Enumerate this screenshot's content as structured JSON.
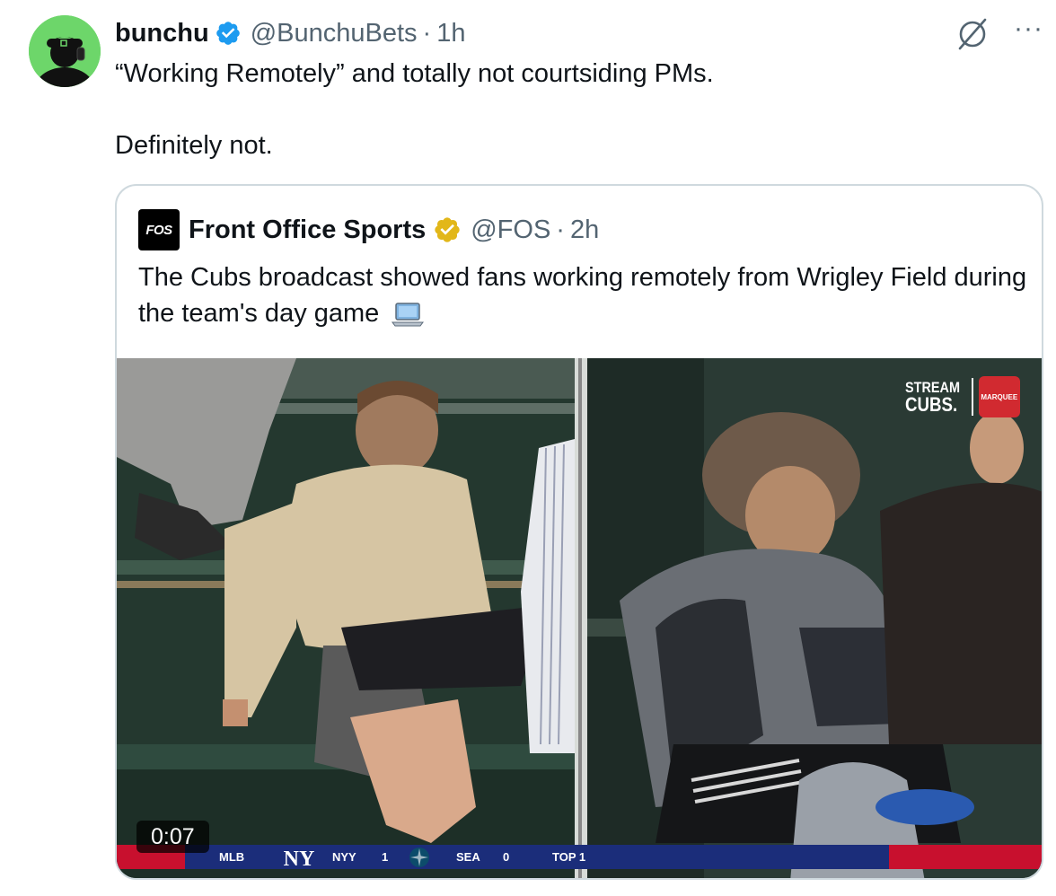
{
  "tweet": {
    "author_name": "bunchu",
    "handle": "@BunchuBets",
    "separator": "·",
    "time": "1h",
    "text_line1": "“Working Remotely” and totally not courtsiding PMs.",
    "text_line2": "Definitely not.",
    "more_label": "···",
    "verified_color": "#1d9bf0",
    "avatar_bg": "#6dd66a"
  },
  "quote": {
    "logo_text": "FOS",
    "author_name": "Front Office Sports",
    "handle": "@FOS",
    "separator": "·",
    "time": "2h",
    "text": "The Cubs broadcast showed fans working remotely from Wrigley Field during the team's day game",
    "emoji_icon": "laptop-icon",
    "verified_color": "#e2b719"
  },
  "video": {
    "timestamp": "0:07",
    "stream_line1": "STREAM",
    "stream_line2": "CUBS.",
    "network_logo": "MARQUEE",
    "scorebar": {
      "league": "MLB",
      "team1": "NYY",
      "score1": "1",
      "team2": "SEA",
      "score2": "0",
      "inning": "TOP 1",
      "bar_color": "#1b2d7a",
      "accent_color": "#c8102e"
    }
  }
}
